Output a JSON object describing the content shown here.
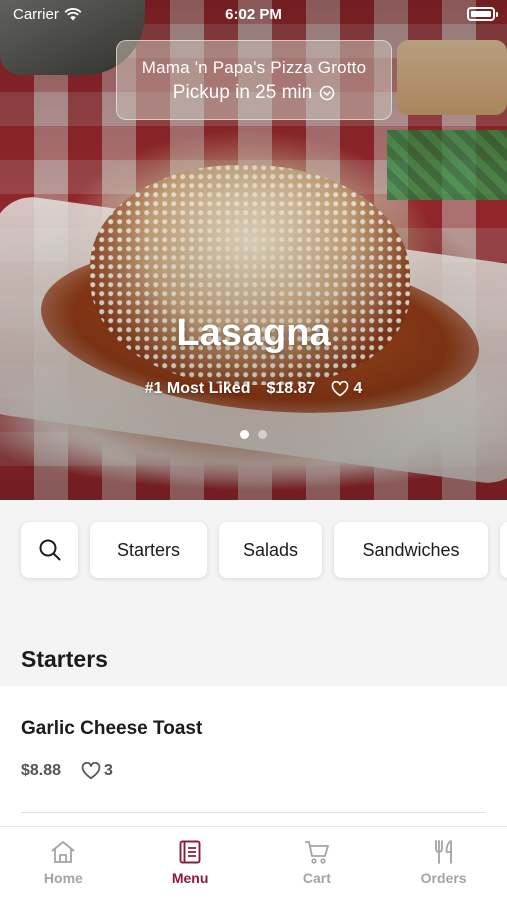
{
  "status_bar": {
    "carrier": "Carrier",
    "time": "6:02 PM"
  },
  "restaurant": {
    "name": "Mama 'n Papa's Pizza Grotto",
    "pickup": "Pickup in 25 min"
  },
  "featured": {
    "title": "Lasagna",
    "badge": "#1 Most Liked",
    "price": "$18.87",
    "likes": "4",
    "page_count": 2,
    "active_page": 0
  },
  "categories": {
    "search_icon": "search-icon",
    "items": [
      "Starters",
      "Salads",
      "Sandwiches",
      ""
    ]
  },
  "section": {
    "title": "Starters"
  },
  "menu_items": [
    {
      "name": "Garlic Cheese Toast",
      "price": "$8.88",
      "likes": "3"
    }
  ],
  "tabs": [
    {
      "label": "Home",
      "icon": "home-icon"
    },
    {
      "label": "Menu",
      "icon": "menu-book-icon"
    },
    {
      "label": "Cart",
      "icon": "cart-icon"
    },
    {
      "label": "Orders",
      "icon": "utensils-icon"
    }
  ],
  "colors": {
    "accent": "#8c1c3d",
    "inactive_tab": "#a4a4a4",
    "background": "#f4f4f4"
  }
}
